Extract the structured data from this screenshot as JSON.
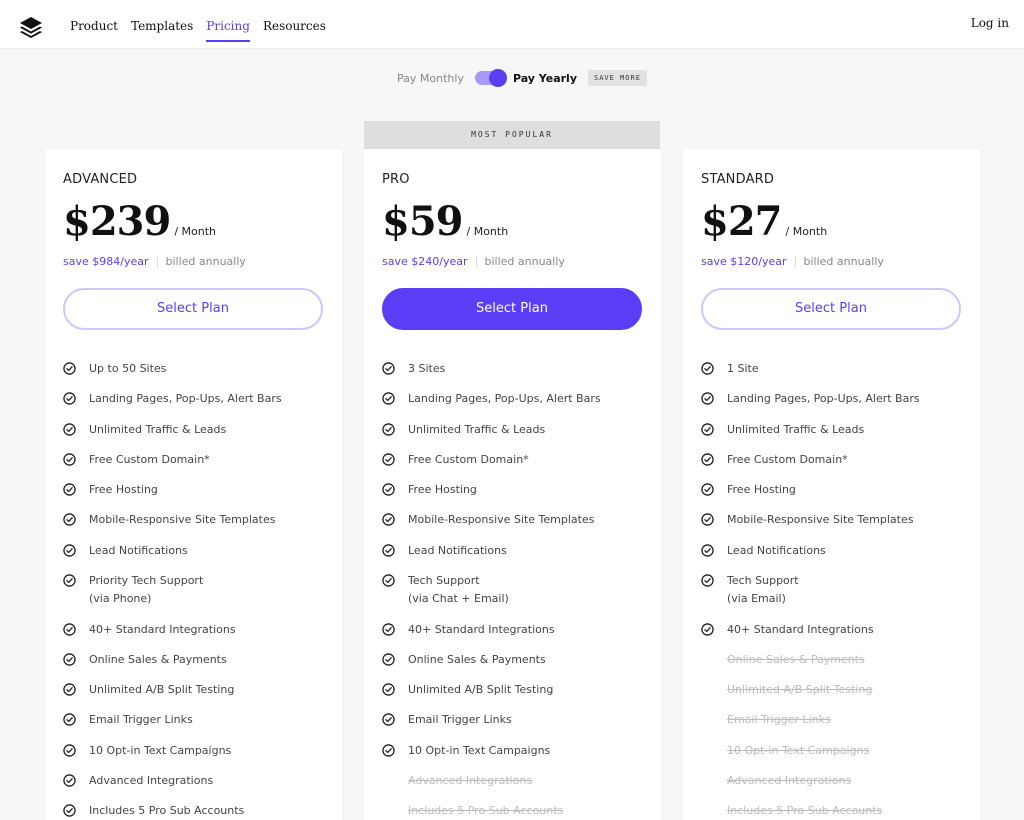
{
  "nav": {
    "items": [
      "Product",
      "Templates",
      "Pricing",
      "Resources"
    ],
    "active": "Pricing",
    "login": "Log in"
  },
  "billing": {
    "monthly": "Pay Monthly",
    "yearly": "Pay Yearly",
    "yearly_selected": true,
    "badge": "SAVE MORE"
  },
  "popular_label": "MOST POPULAR",
  "accent_color": "#5b3df5",
  "plans": [
    {
      "name": "ADVANCED",
      "price": "$239",
      "per": "/ Month",
      "save": "save $984/year",
      "billed": "billed annually",
      "button": "Select Plan",
      "features": [
        {
          "text": "Up to 50 Sites",
          "included": true
        },
        {
          "text": "Landing Pages, Pop-Ups, Alert Bars",
          "included": true
        },
        {
          "text": "Unlimited Traffic & Leads",
          "included": true
        },
        {
          "text": "Free Custom Domain*",
          "included": true
        },
        {
          "text": "Free Hosting",
          "included": true
        },
        {
          "text": "Mobile-Responsive Site Templates",
          "included": true
        },
        {
          "text": "Lead Notifications",
          "included": true
        },
        {
          "text": "Priority Tech Support",
          "sub": "(via Phone)",
          "included": true
        },
        {
          "text": "40+ Standard Integrations",
          "included": true
        },
        {
          "text": "Online Sales & Payments",
          "included": true
        },
        {
          "text": "Unlimited A/B Split Testing",
          "included": true
        },
        {
          "text": "Email Trigger Links",
          "included": true
        },
        {
          "text": "10 Opt-in Text Campaigns",
          "included": true
        },
        {
          "text": "Advanced Integrations",
          "included": true
        },
        {
          "text": "Includes 5 Pro Sub Accounts",
          "included": true
        }
      ]
    },
    {
      "name": "PRO",
      "price": "$59",
      "per": "/ Month",
      "save": "save $240/year",
      "billed": "billed annually",
      "button": "Select Plan",
      "features": [
        {
          "text": "3 Sites",
          "included": true
        },
        {
          "text": "Landing Pages, Pop-Ups, Alert Bars",
          "included": true
        },
        {
          "text": "Unlimited Traffic & Leads",
          "included": true
        },
        {
          "text": "Free Custom Domain*",
          "included": true
        },
        {
          "text": "Free Hosting",
          "included": true
        },
        {
          "text": "Mobile-Responsive Site Templates",
          "included": true
        },
        {
          "text": "Lead Notifications",
          "included": true
        },
        {
          "text": "Tech Support",
          "sub": "(via Chat + Email)",
          "included": true
        },
        {
          "text": "40+ Standard Integrations",
          "included": true
        },
        {
          "text": "Online Sales & Payments",
          "included": true
        },
        {
          "text": "Unlimited A/B Split Testing",
          "included": true
        },
        {
          "text": "Email Trigger Links",
          "included": true
        },
        {
          "text": "10 Opt-in Text Campaigns",
          "included": true
        },
        {
          "text": "Advanced Integrations",
          "included": false
        },
        {
          "text": "Includes 5 Pro Sub Accounts",
          "included": false
        }
      ]
    },
    {
      "name": "STANDARD",
      "price": "$27",
      "per": "/ Month",
      "save": "save $120/year",
      "billed": "billed annually",
      "button": "Select Plan",
      "features": [
        {
          "text": "1 Site",
          "included": true
        },
        {
          "text": "Landing Pages, Pop-Ups, Alert Bars",
          "included": true
        },
        {
          "text": "Unlimited Traffic & Leads",
          "included": true
        },
        {
          "text": "Free Custom Domain*",
          "included": true
        },
        {
          "text": "Free Hosting",
          "included": true
        },
        {
          "text": "Mobile-Responsive Site Templates",
          "included": true
        },
        {
          "text": "Lead Notifications",
          "included": true
        },
        {
          "text": "Tech Support",
          "sub": "(via Email)",
          "included": true
        },
        {
          "text": "40+ Standard Integrations",
          "included": true
        },
        {
          "text": "Online Sales & Payments",
          "included": false
        },
        {
          "text": "Unlimited A/B Split Testing",
          "included": false
        },
        {
          "text": "Email Trigger Links",
          "included": false
        },
        {
          "text": "10 Opt-in Text Campaigns",
          "included": false
        },
        {
          "text": "Advanced Integrations",
          "included": false
        },
        {
          "text": "Includes 5 Pro Sub Accounts",
          "included": false
        }
      ]
    }
  ]
}
